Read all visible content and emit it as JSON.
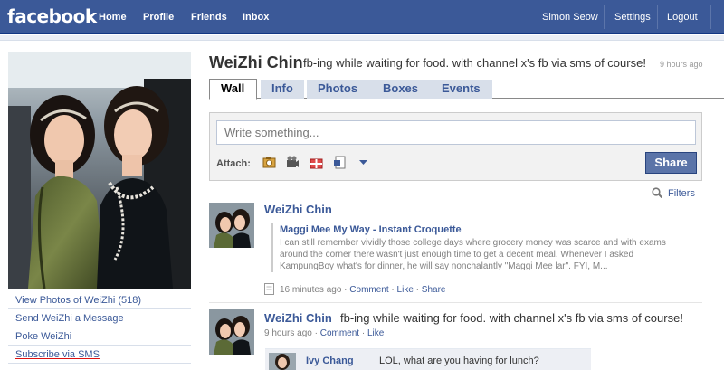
{
  "topnav": {
    "logo": "facebook",
    "left": [
      "Home",
      "Profile",
      "Friends",
      "Inbox"
    ],
    "right": [
      "Simon Seow",
      "Settings",
      "Logout"
    ]
  },
  "profile": {
    "name": "WeiZhi Chin",
    "status": "fb-ing while waiting for food. with channel x's fb via sms of course!",
    "status_time": "9 hours ago"
  },
  "sidebar_links": [
    "View Photos of WeiZhi (518)",
    "Send WeiZhi a Message",
    "Poke WeiZhi",
    "Subscribe via SMS"
  ],
  "tabs": [
    "Wall",
    "Info",
    "Photos",
    "Boxes",
    "Events"
  ],
  "publisher": {
    "placeholder": "Write something...",
    "attach_label": "Attach:",
    "share_label": "Share",
    "attach_icons": [
      "photo-icon",
      "video-icon",
      "gift-icon",
      "link-icon",
      "dropdown-arrow-icon"
    ]
  },
  "filters_label": "Filters",
  "stories": [
    {
      "author": "WeiZhi Chin",
      "attachment_title": "Maggi Mee My Way - Instant Croquette",
      "attachment_lines": [
        "I can still remember vividly those college days where grocery money was scarce and with exams",
        "around the corner there wasn't just enough time to get a decent meal. Whenever I asked",
        "KampungBoy what's for dinner, he will say nonchalantly \"Maggi Mee lar\". FYI, M..."
      ],
      "time": "16 minutes ago",
      "actions": [
        "Comment",
        "Like",
        "Share"
      ]
    },
    {
      "author": "WeiZhi Chin",
      "text": "fb-ing while waiting for food. with channel x's fb via sms of course!",
      "time": "9 hours ago",
      "actions": [
        "Comment",
        "Like"
      ],
      "comment": {
        "author": "Ivy Chang",
        "text": "LOL, what are you having for lunch?"
      }
    }
  ],
  "colors": {
    "brand": "#3b5998",
    "link": "#3b5998",
    "share_button": "#5b74a8",
    "tab_inactive": "#d8dfea"
  }
}
